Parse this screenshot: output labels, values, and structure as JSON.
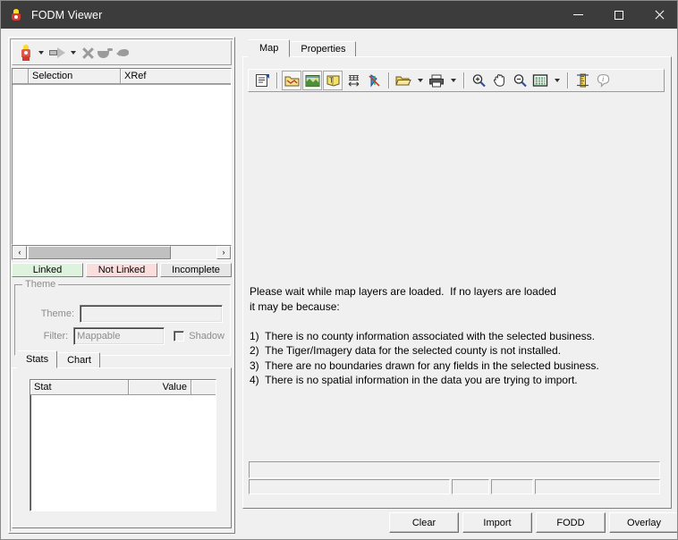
{
  "window": {
    "title": "FODM Viewer",
    "app_icon": "person-figure-icon",
    "controls": {
      "minimize": "minimize-icon",
      "maximize": "maximize-icon",
      "close": "close-icon"
    }
  },
  "left_panel": {
    "toolbar": [
      {
        "name": "add-selection-button",
        "icon": "person-figure-icon",
        "has_dropdown": true
      },
      {
        "name": "transfer-button",
        "icon": "arrow-right-icon",
        "has_dropdown": true
      },
      {
        "name": "delete-button",
        "icon": "x-icon",
        "has_dropdown": false
      },
      {
        "name": "trowel-tool-button",
        "icon": "trowel-icon",
        "has_dropdown": false
      },
      {
        "name": "stone-tool-button",
        "icon": "stone-icon",
        "has_dropdown": false
      }
    ],
    "selection_list": {
      "columns": [
        "",
        "Selection",
        "XRef"
      ],
      "rows": []
    },
    "scrollbar": {
      "left_arrow": "‹",
      "right_arrow": "›"
    },
    "status_tabs": [
      {
        "label": "Linked",
        "color": "#ddf3dd"
      },
      {
        "label": "Not Linked",
        "color": "#fadede"
      },
      {
        "label": "Incomplete",
        "color": "#e6e6e6"
      }
    ],
    "theme_group": {
      "legend": "Theme",
      "theme_label": "Theme:",
      "theme_value": "",
      "filter_label": "Filter:",
      "filter_value": "Mappable",
      "shadow_label": "Shadow",
      "shadow_checked": false,
      "enabled": false
    },
    "bottom_tabs": [
      {
        "label": "Stats",
        "active": true
      },
      {
        "label": "Chart",
        "active": false
      }
    ],
    "stats_grid": {
      "columns": [
        "Stat",
        "Value",
        ""
      ],
      "rows": []
    }
  },
  "right_panel": {
    "tabs": [
      {
        "label": "Map",
        "active": true
      },
      {
        "label": "Properties",
        "active": false
      }
    ],
    "toolbar": [
      {
        "name": "layer-properties-button",
        "icon": "properties-sheet-icon"
      },
      {
        "name": "open-theme-button",
        "icon": "folder-map-icon"
      },
      {
        "name": "imagery-layer-button",
        "icon": "imagery-layer-icon"
      },
      {
        "name": "label-layer-button",
        "icon": "label-layer-icon"
      },
      {
        "name": "grid-button",
        "icon": "grid-icon"
      },
      {
        "name": "clear-selection-button",
        "icon": "clear-selection-icon"
      },
      {
        "name": "open-button",
        "icon": "folder-open-icon"
      },
      {
        "name": "print-button",
        "icon": "printer-icon"
      },
      {
        "name": "zoom-in-button",
        "icon": "zoom-in-icon"
      },
      {
        "name": "pan-button",
        "icon": "hand-icon"
      },
      {
        "name": "zoom-out-button",
        "icon": "zoom-out-icon"
      },
      {
        "name": "full-extent-button",
        "icon": "full-extent-icon"
      },
      {
        "name": "measure-button",
        "icon": "ruler-icon"
      },
      {
        "name": "identify-button",
        "icon": "info-icon"
      }
    ],
    "message": "Please wait while map layers are loaded.  If no layers are loaded\nit may be because:\n\n1)  There is no county information associated with the selected business.\n2)  The Tiger/Imagery data for the selected county is not installed.\n3)  There are no boundaries drawn for any fields in the selected business.\n4)  There is no spatial information in the data you are trying to import.",
    "status_bar_primary": "",
    "status_bar_cells": [
      "",
      "",
      "",
      ""
    ]
  },
  "buttons": [
    {
      "label": "Clear",
      "name": "clear-button"
    },
    {
      "label": "Import",
      "name": "import-button"
    },
    {
      "label": "FODD",
      "name": "fodd-button"
    },
    {
      "label": "Overlay",
      "name": "overlay-button"
    }
  ],
  "colors": {
    "titlebar": "#3c3c3c",
    "window_face": "#f0f0f0",
    "linked": "#ddf3dd",
    "not_linked": "#fadede",
    "incomplete": "#e6e6e6"
  }
}
